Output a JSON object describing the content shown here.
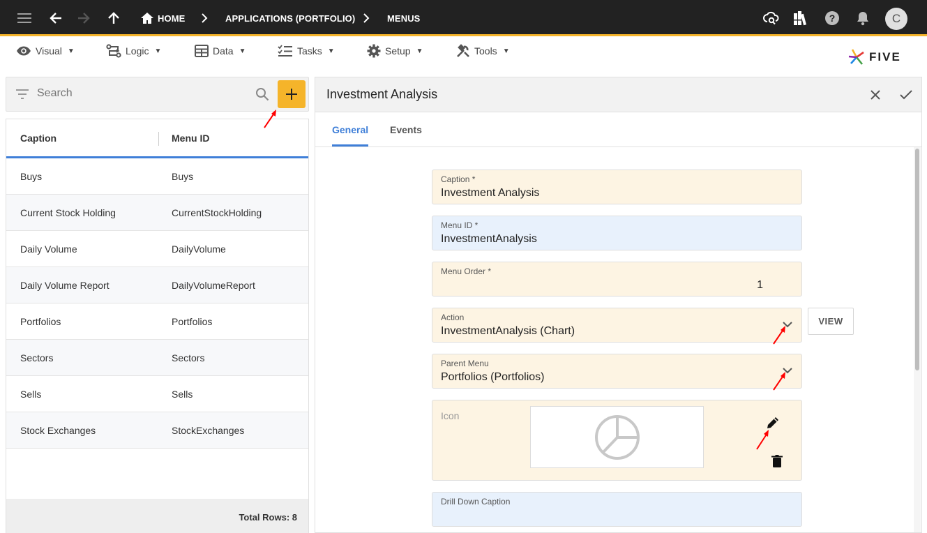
{
  "topbar": {
    "breadcrumbs": [
      "HOME",
      "APPLICATIONS (PORTFOLIO)",
      "MENUS"
    ],
    "avatar_letter": "C"
  },
  "menubar": {
    "items": [
      {
        "label": "Visual",
        "icon": "eye-icon"
      },
      {
        "label": "Logic",
        "icon": "logic-icon"
      },
      {
        "label": "Data",
        "icon": "table-icon"
      },
      {
        "label": "Tasks",
        "icon": "tasks-icon"
      },
      {
        "label": "Setup",
        "icon": "gear-icon"
      },
      {
        "label": "Tools",
        "icon": "tools-icon"
      }
    ],
    "logo_text": "FIVE"
  },
  "list": {
    "search_placeholder": "Search",
    "columns": [
      "Caption",
      "Menu ID"
    ],
    "rows": [
      [
        "Buys",
        "Buys"
      ],
      [
        "Current Stock Holding",
        "CurrentStockHolding"
      ],
      [
        "Daily Volume",
        "DailyVolume"
      ],
      [
        "Daily Volume Report",
        "DailyVolumeReport"
      ],
      [
        "Portfolios",
        "Portfolios"
      ],
      [
        "Sectors",
        "Sectors"
      ],
      [
        "Sells",
        "Sells"
      ],
      [
        "Stock Exchanges",
        "StockExchanges"
      ]
    ],
    "total_rows": "Total Rows: 8"
  },
  "form": {
    "title": "Investment Analysis",
    "tabs": [
      "General",
      "Events"
    ],
    "fields": {
      "caption": {
        "label": "Caption *",
        "value": "Investment Analysis"
      },
      "menu_id": {
        "label": "Menu ID *",
        "value": "InvestmentAnalysis"
      },
      "menu_order": {
        "label": "Menu Order *",
        "value": "1"
      },
      "action": {
        "label": "Action",
        "value": "InvestmentAnalysis (Chart)"
      },
      "parent_menu": {
        "label": "Parent Menu",
        "value": "Portfolios (Portfolios)"
      },
      "icon": {
        "label": "Icon",
        "preview": "pie-chart-icon"
      },
      "drill_down": {
        "label": "Drill Down Caption",
        "value": ""
      }
    },
    "view_label": "VIEW"
  },
  "colors": {
    "accent": "#f5b42a",
    "tab_active": "#3f7fd8",
    "field_tan": "#fdf4e3",
    "field_blue": "#e8f1fc",
    "annotation": "#ff0000"
  }
}
